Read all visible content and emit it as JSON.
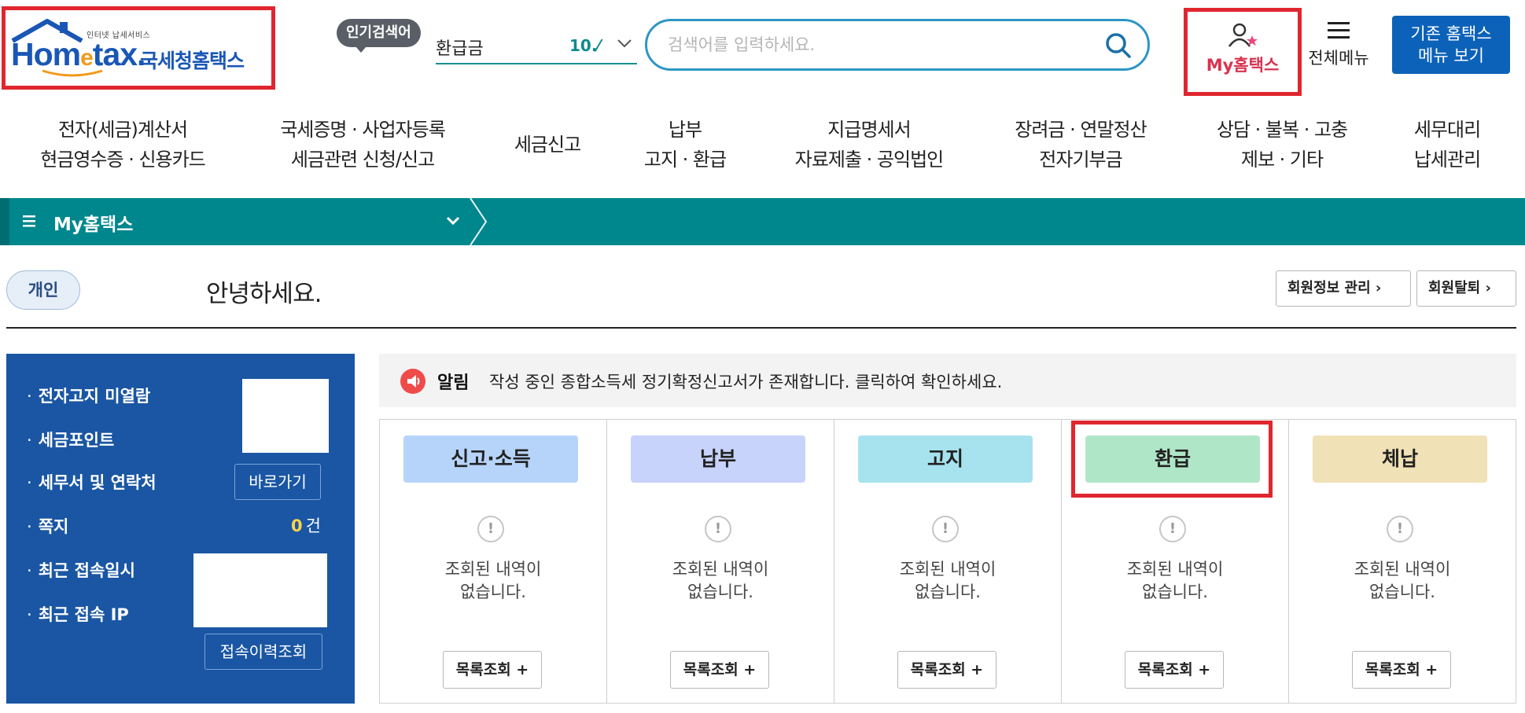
{
  "header": {
    "logo_sub": "인터넷 납세서비스",
    "logo_brand": "Hom",
    "logo_brand_e": "e",
    "logo_brand_tail": "tax.",
    "logo_kr": "국세청홈택스",
    "popular_badge": "인기검색어",
    "popular_term": "환급금",
    "popular_rank": "10.⁄",
    "search_placeholder": "검색어를 입력하세요.",
    "my_hometax": "My홈택스",
    "all_menu": "전체메뉴",
    "legacy_line1": "기존 홈택스",
    "legacy_line2": "메뉴 보기"
  },
  "gnb": [
    {
      "line1": "전자(세금)계산서",
      "line2": "현금영수증 · 신용카드"
    },
    {
      "line1": "국세증명 · 사업자등록",
      "line2": "세금관련 신청/신고"
    },
    {
      "line1": "세금신고",
      "line2": ""
    },
    {
      "line1": "납부",
      "line2": "고지 · 환급"
    },
    {
      "line1": "지급명세서",
      "line2": "자료제출 · 공익법인"
    },
    {
      "line1": "장려금 · 연말정산",
      "line2": "전자기부금"
    },
    {
      "line1": "상담 · 불복 · 고충",
      "line2": "제보 · 기타"
    },
    {
      "line1": "세무대리",
      "line2": "납세관리"
    }
  ],
  "subbar": {
    "title": "My홈택스"
  },
  "greeting": {
    "user_type": "개인",
    "text": "안녕하세요.",
    "member_info": "회원정보 관리 ›",
    "withdraw": "회원탈퇴 ›"
  },
  "left_panel": {
    "unread_notice": "전자고지 미열람",
    "tax_points": "세금포인트",
    "tax_office": "세무서 및 연락처",
    "shortcut": "바로가기",
    "notes": "쪽지",
    "notes_count": "0",
    "notes_unit": "건",
    "last_access": "최근 접속일시",
    "last_ip": "최근 접속 IP",
    "access_history": "접속이력조회"
  },
  "notice": {
    "tag": "알림",
    "text": "작성 중인 종합소득세 정기확정신고서가 존재합니다. 클릭하여 확인하세요."
  },
  "status": {
    "empty_line1": "조회된 내역이",
    "empty_line2": "없습니다.",
    "list_button": "목록조회 +",
    "columns": [
      {
        "label": "신고·소득",
        "color": "#b6d4fa"
      },
      {
        "label": "납부",
        "color": "#c7d3fb"
      },
      {
        "label": "고지",
        "color": "#a6e3ef"
      },
      {
        "label": "환급",
        "color": "#b0e6c8"
      },
      {
        "label": "체납",
        "color": "#f1e1b6"
      }
    ]
  },
  "colors": {
    "highlight": "#e0262e",
    "teal": "#00878e",
    "panel_blue": "#1a56a3",
    "legacy_blue": "#0c62b8"
  }
}
